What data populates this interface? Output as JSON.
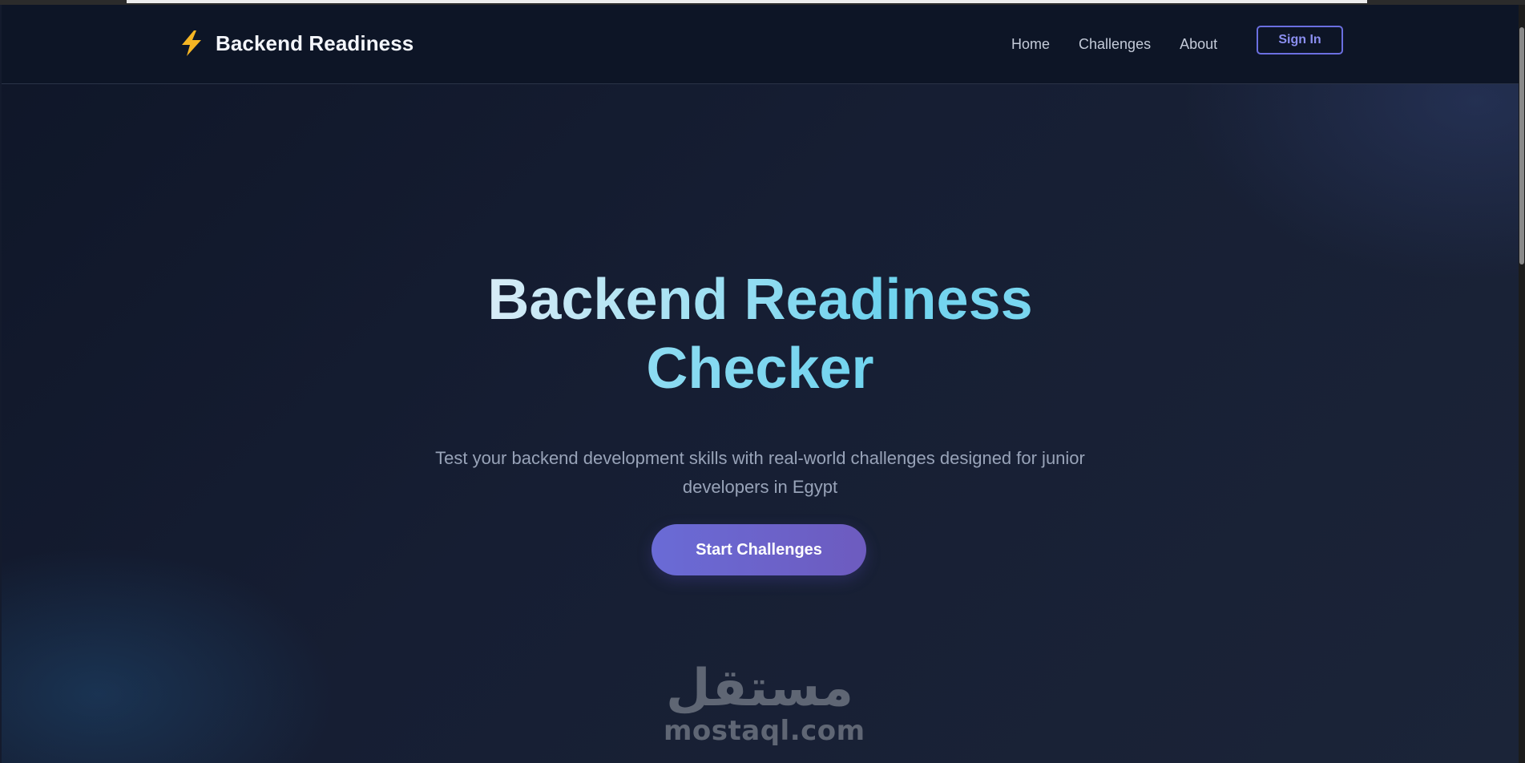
{
  "colors": {
    "background": "#141b2d",
    "navbar": "#0d1526",
    "accent": "#6b6fe0",
    "title_gradient_start": "#d9ecf7",
    "title_gradient_end": "#6fd3ee",
    "bolt": "#f5b523"
  },
  "header": {
    "brand_icon": "lightning-bolt-icon",
    "brand_name": "Backend Readiness",
    "nav": [
      {
        "label": "Home"
      },
      {
        "label": "Challenges"
      },
      {
        "label": "About"
      }
    ],
    "signin_label": "Sign In"
  },
  "hero": {
    "title_line1": "Backend Readiness",
    "title_line2": "Checker",
    "subtitle_line1": "Test your backend development skills with real-world challenges designed for junior",
    "subtitle_line2": "developers in Egypt",
    "cta_label": "Start Challenges"
  },
  "watermark": {
    "arabic": "مستقل",
    "latin": "mostaql.com"
  }
}
